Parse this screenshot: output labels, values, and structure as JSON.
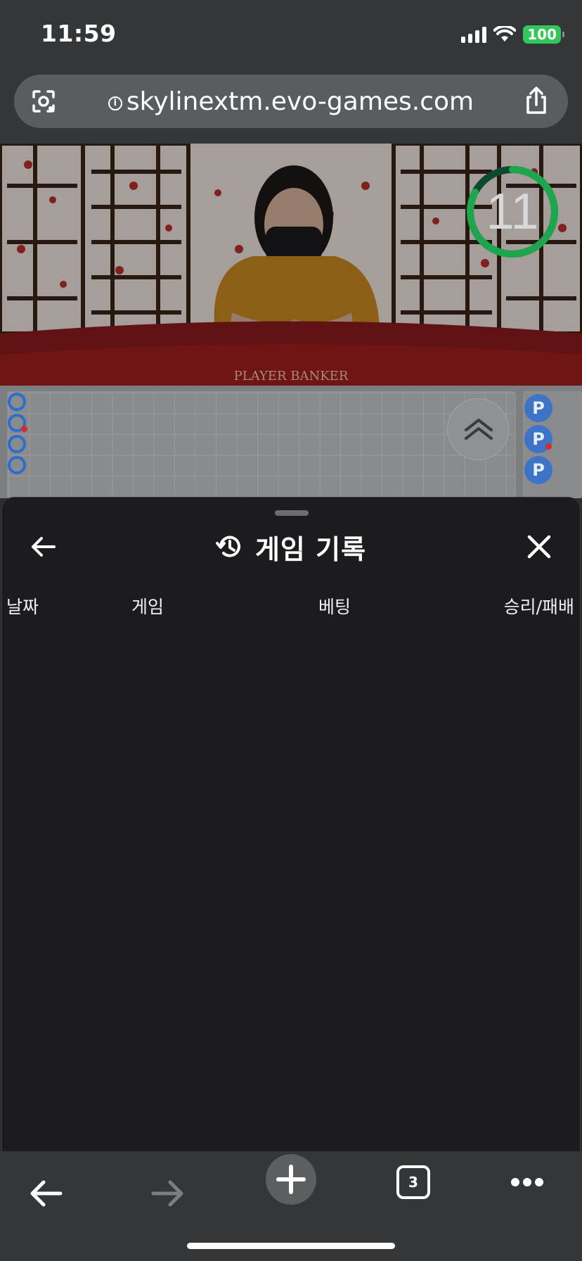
{
  "status_bar": {
    "time": "11:59",
    "battery": "100"
  },
  "browser": {
    "url": "skylinextm.evo-games.com"
  },
  "video": {
    "countdown": "11",
    "table_text": "PLAYER BANKER"
  },
  "history": {
    "title": "게임 기록",
    "columns": [
      "날짜",
      "게임",
      "베팅",
      "승리/패배"
    ]
  },
  "roadmap": {
    "chip_label": "P"
  },
  "toolbar": {
    "tab_count": "3"
  }
}
